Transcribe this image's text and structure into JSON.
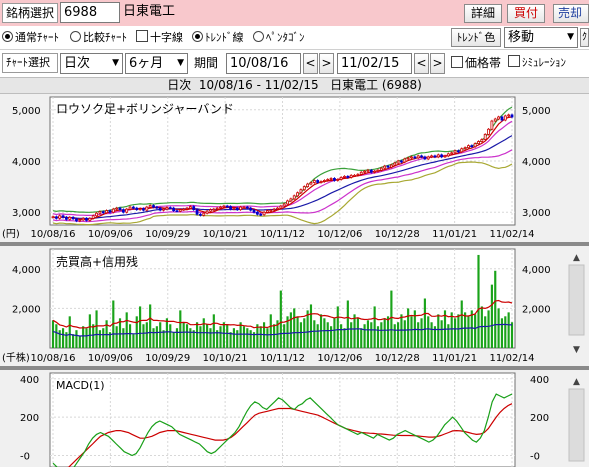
{
  "header": {
    "symbol_label": "銘柄選択",
    "symbol_code": "6988",
    "company_name": "日東電工",
    "buttons": {
      "details": "詳細",
      "buy": "買付",
      "sell": "売却"
    }
  },
  "chart_options": {
    "normal": "通常ﾁｬｰﾄ",
    "compare": "比較ﾁｬｰﾄ",
    "crosshair": "十字線",
    "trendline": "ﾄﾚﾝﾄﾞ線",
    "pentagon": "ﾍﾟﾝﾀｺﾞﾝ",
    "trend_color": "ﾄﾚﾝﾄﾞ色",
    "mode_select": "移動"
  },
  "selection_row": {
    "chart_select_label": "ﾁｬｰﾄ選択",
    "interval": "日次",
    "range": "6ヶ月",
    "period_label": "期間",
    "start_date": "10/08/16",
    "end_date": "11/02/15",
    "price_band": "価格帯",
    "simulation": "ｼﾐｭﾚｰｼｮﾝ",
    "prev": "<",
    "next": ">"
  },
  "title_bar": {
    "interval": "日次",
    "range": "10/08/16 - 11/02/15",
    "company": "日東電工 (6988)"
  },
  "icons": {
    "dropdown": "chevron-down-icon",
    "scroll_up": "triangle-up-icon",
    "scroll_down": "triangle-down-icon"
  },
  "colors": {
    "header_bg": "#f8c8cc",
    "panel_bg": "#f0f0f0",
    "candle_up": "#cc0000",
    "candle_down": "#0000cc",
    "volume": "#1aa31a",
    "macd": "#19a019",
    "signal": "#cc0000"
  },
  "chart_data": [
    {
      "type": "candlestick",
      "title": "ロウソク足+ボリンジャーバンド",
      "unit_label": "(円)",
      "x_ticks": [
        "10/08/16",
        "10/09/06",
        "10/09/29",
        "10/10/21",
        "10/11/12",
        "10/12/06",
        "10/12/28",
        "11/01/21",
        "11/02/14"
      ],
      "y_ticks": [
        3000,
        4000,
        5000
      ],
      "y_tick_labels": [
        "3,000",
        "4,000",
        "5,000"
      ],
      "ylim": [
        2750,
        5250
      ],
      "close": [
        2910,
        2880,
        2930,
        2900,
        2860,
        2900,
        2870,
        2830,
        2850,
        2880,
        2840,
        2880,
        2930,
        2980,
        3010,
        2990,
        3030,
        3000,
        3060,
        3080,
        3050,
        3000,
        3060,
        3100,
        3080,
        3050,
        3070,
        3040,
        3100,
        3130,
        3100,
        3080,
        3040,
        3060,
        3090,
        3080,
        3030,
        3020,
        3050,
        3060,
        3080,
        3110,
        3050,
        2960,
        2940,
        2980,
        3020,
        3050,
        3060,
        3080,
        3100,
        3120,
        3110,
        3060,
        3080,
        3050,
        3100,
        3100,
        3080,
        3040,
        3000,
        2960,
        2950,
        3000,
        3030,
        3040,
        3060,
        3080,
        3120,
        3160,
        3220,
        3260,
        3320,
        3380,
        3440,
        3500,
        3550,
        3580,
        3620,
        3580,
        3600,
        3620,
        3640,
        3660,
        3620,
        3640,
        3680,
        3700,
        3680,
        3720,
        3720,
        3740,
        3780,
        3800,
        3820,
        3780,
        3800,
        3820,
        3860,
        3900,
        3880,
        3920,
        3960,
        4000,
        3980,
        4040,
        4060,
        4080,
        4060,
        4100,
        4080,
        4040,
        4080,
        4100,
        4080,
        4120,
        4080,
        4100,
        4140,
        4160,
        4200,
        4180,
        4240,
        4260,
        4300,
        4280,
        4340,
        4380,
        4420,
        4520,
        4620,
        4780,
        4820,
        4860,
        4800,
        4880,
        4900,
        4860
      ],
      "series": [
        {
          "name": "",
          "color": "#1a1aa8"
        },
        {
          "name": "",
          "color": "#cc0000"
        },
        {
          "name": "",
          "color": "#cc33cc"
        },
        {
          "name": "",
          "color": "#3aa03a"
        },
        {
          "name": "",
          "color": "#a8a832"
        }
      ]
    },
    {
      "type": "bar",
      "title": "売買高+信用残",
      "unit_label": "(千株)",
      "x_ticks": [
        "10/08/16",
        "10/09/06",
        "10/09/29",
        "10/10/21",
        "10/11/12",
        "10/12/06",
        "10/12/28",
        "11/01/21",
        "11/02/14"
      ],
      "y_ticks": [
        2000,
        4000
      ],
      "y_tick_labels": [
        "2,000",
        "4,000"
      ],
      "ylim": [
        0,
        5000
      ],
      "volume": [
        1400,
        1200,
        900,
        1000,
        800,
        1600,
        700,
        900,
        600,
        1100,
        1000,
        1700,
        1200,
        1900,
        900,
        1000,
        1400,
        800,
        2400,
        1100,
        1500,
        1000,
        1800,
        1200,
        700,
        1600,
        2100,
        1200,
        1300,
        2200,
        1000,
        1100,
        1300,
        900,
        1500,
        1200,
        800,
        1000,
        1900,
        1300,
        1200,
        1000,
        900,
        1300,
        1100,
        1500,
        1200,
        1000,
        1700,
        900,
        1100,
        1300,
        1200,
        800,
        1000,
        900,
        1300,
        1100,
        1000,
        900,
        800,
        1200,
        1100,
        1300,
        1000,
        1700,
        1200,
        1400,
        2900,
        1200,
        1600,
        1800,
        2000,
        1600,
        1300,
        1500,
        1900,
        2200,
        1400,
        1200,
        1700,
        1500,
        1300,
        1100,
        1500,
        2100,
        1200,
        1000,
        2400,
        1300,
        1700,
        1500,
        1000,
        1200,
        1400,
        1300,
        2100,
        1100,
        1300,
        1500,
        1600,
        2900,
        1200,
        1300,
        1700,
        1400,
        2000,
        1600,
        1900,
        1300,
        1500,
        2500,
        1600,
        1300,
        1100,
        1700,
        1400,
        1900,
        1200,
        1800,
        1500,
        1700,
        2400,
        1800,
        1600,
        1900,
        1700,
        4700,
        2100,
        1600,
        1900,
        3200,
        3900,
        2000,
        1500,
        1600,
        1800,
        1300
      ],
      "series": [
        {
          "name": "",
          "color": "#cc0000"
        },
        {
          "name": "",
          "color": "#1a1aa8"
        }
      ]
    },
    {
      "type": "line",
      "title": "MACD(1)",
      "y_ticks": [
        0,
        200,
        400
      ],
      "y_tick_labels": [
        "-0",
        "200",
        "400"
      ],
      "ylim": [
        -60,
        430
      ],
      "macd": [
        -40,
        -60,
        -80,
        -90,
        -80,
        -70,
        -40,
        -10,
        20,
        60,
        90,
        110,
        120,
        110,
        100,
        80,
        60,
        40,
        20,
        10,
        0,
        10,
        40,
        80,
        120,
        150,
        170,
        180,
        170,
        160,
        150,
        130,
        110,
        100,
        90,
        80,
        70,
        60,
        40,
        20,
        10,
        20,
        40,
        60,
        80,
        100,
        120,
        150,
        190,
        230,
        260,
        280,
        270,
        250,
        240,
        260,
        280,
        300,
        290,
        270,
        250,
        240,
        260,
        270,
        290,
        300,
        280,
        260,
        240,
        220,
        200,
        180,
        160,
        150,
        140,
        130,
        120,
        110,
        120,
        110,
        100,
        90,
        110,
        100,
        90,
        80,
        90,
        110,
        120,
        130,
        120,
        110,
        100,
        90,
        80,
        70,
        80,
        100,
        130,
        160,
        180,
        200,
        180,
        150,
        120,
        100,
        80,
        70,
        90,
        130,
        200,
        280,
        320,
        310,
        300,
        310,
        320
      ],
      "signal": [
        -70,
        -70,
        -70,
        -70,
        -60,
        -40,
        -20,
        0,
        20,
        40,
        60,
        80,
        100,
        110,
        120,
        125,
        130,
        130,
        125,
        120,
        110,
        100,
        90,
        90,
        95,
        100,
        110,
        120,
        125,
        130,
        130,
        130,
        125,
        120,
        115,
        110,
        105,
        100,
        95,
        90,
        85,
        80,
        80,
        80,
        85,
        95,
        110,
        130,
        150,
        170,
        190,
        210,
        220,
        225,
        230,
        235,
        240,
        245,
        245,
        245,
        245,
        240,
        235,
        230,
        225,
        220,
        215,
        210,
        200,
        190,
        180,
        170,
        160,
        150,
        140,
        135,
        130,
        125,
        120,
        118,
        116,
        115,
        113,
        112,
        110,
        108,
        106,
        105,
        104,
        104,
        104,
        103,
        102,
        100,
        98,
        96,
        96,
        98,
        104,
        112,
        120,
        128,
        130,
        128,
        125,
        120,
        114,
        110,
        112,
        120,
        140,
        170,
        200,
        225,
        245,
        260,
        270
      ]
    }
  ]
}
